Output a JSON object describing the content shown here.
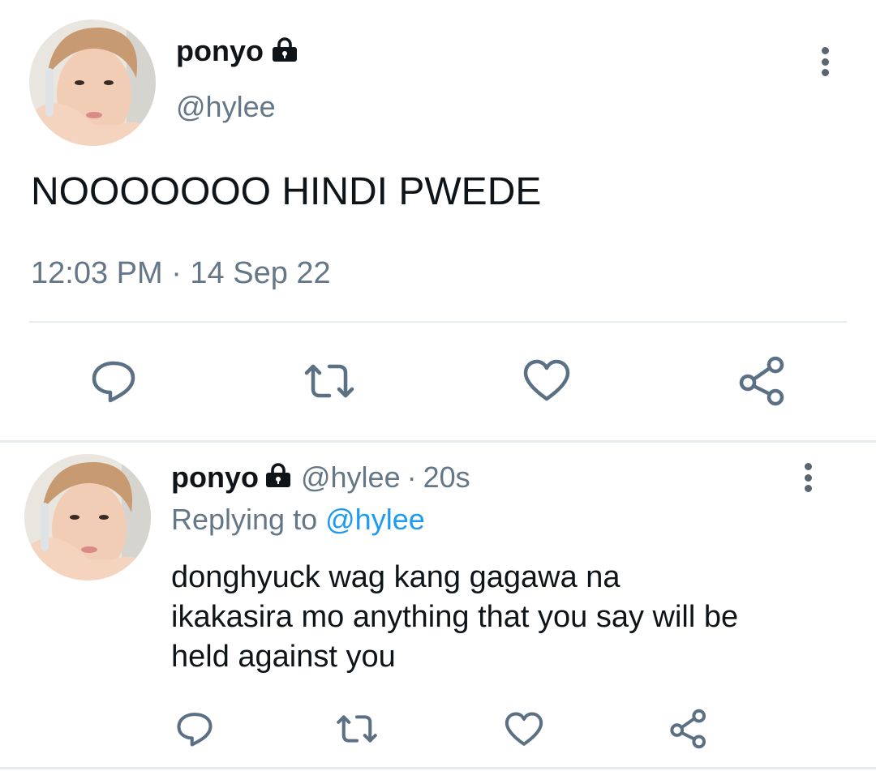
{
  "main_tweet": {
    "display_name": "ponyo",
    "handle": "@hylee",
    "text": "NOOOOOOO HINDI PWEDE",
    "timestamp": "12:03 PM · 14 Sep 22",
    "avatar_icon": "avatar-photo-icon",
    "protected_icon": "lock-icon"
  },
  "reply_tweet": {
    "display_name": "ponyo",
    "handle": "@hylee",
    "dot": "·",
    "time": "20s",
    "replying_prefix": "Replying to",
    "replying_handle": "@hylee",
    "text_lines": [
      "donghyuck wag kang gagawa na",
      "ikakasira mo anything that you say will be",
      "held against you"
    ]
  },
  "actions": [
    "reply-icon",
    "retweet-icon",
    "like-icon",
    "share-icon"
  ],
  "colors": {
    "text": "#0f1419",
    "secondary": "#657786",
    "link": "#1d9bf0",
    "divider": "#e6ecf0",
    "icon": "#5b7083"
  }
}
